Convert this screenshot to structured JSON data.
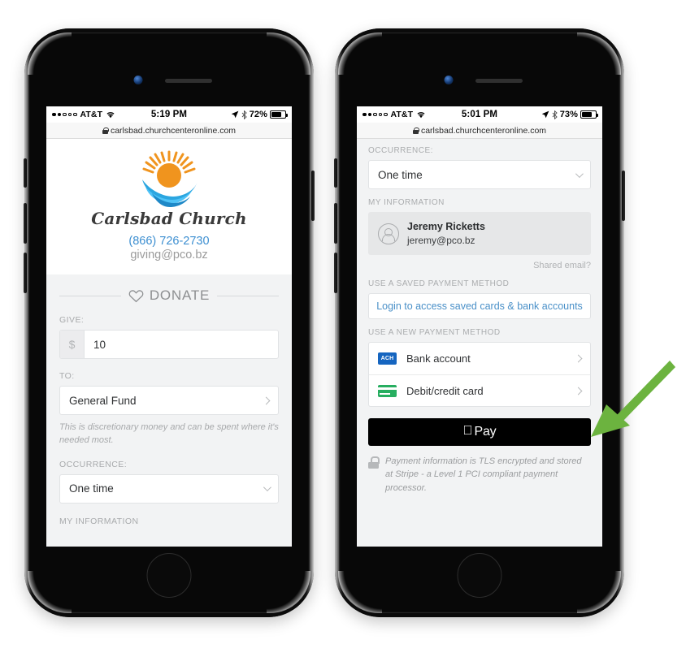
{
  "phones": {
    "left": {
      "status_bar": {
        "signal_dots_filled": 2,
        "signal_dots_total": 5,
        "carrier": "AT&T",
        "wifi_icon": "wifi-icon",
        "time": "5:19 PM",
        "location_icon": "location-arrow-icon",
        "bluetooth_icon": "bluetooth-icon",
        "battery_percent": "72%",
        "battery_level": 72
      },
      "url_bar": {
        "lock_icon": "lock-icon",
        "url": "carlsbad.churchcenteronline.com"
      },
      "hero": {
        "logo_icon": "sun-wave-logo-icon",
        "church_name": "Carlsbad Church",
        "phone": "(866) 726-2730",
        "email": "giving@pco.bz"
      },
      "donate_header": {
        "heart_icon": "heart-outline-icon",
        "title": "DONATE"
      },
      "form": {
        "give_label": "GIVE:",
        "currency_symbol": "$",
        "amount_value": "10",
        "to_label": "TO:",
        "fund_value": "General Fund",
        "fund_chevron_icon": "chevron-right-icon",
        "fund_helper": "This is discretionary money and can be spent where it's needed most.",
        "occurrence_label": "OCCURRENCE:",
        "occurrence_value": "One time",
        "occurrence_chevron_icon": "chevron-down-icon",
        "next_section_label": "MY INFORMATION"
      }
    },
    "right": {
      "status_bar": {
        "signal_dots_filled": 2,
        "signal_dots_total": 5,
        "carrier": "AT&T",
        "wifi_icon": "wifi-icon",
        "time": "5:01 PM",
        "location_icon": "location-arrow-icon",
        "bluetooth_icon": "bluetooth-icon",
        "battery_percent": "73%",
        "battery_level": 73
      },
      "url_bar": {
        "lock_icon": "lock-icon",
        "url": "carlsbad.churchcenteronline.com"
      },
      "occurrence": {
        "label": "OCCURRENCE:",
        "value": "One time",
        "chevron_icon": "chevron-down-icon"
      },
      "my_information": {
        "label": "MY INFORMATION",
        "avatar_icon": "person-avatar-icon",
        "name": "Jeremy Ricketts",
        "email": "jeremy@pco.bz",
        "shared_email_link": "Shared email?"
      },
      "saved_payment": {
        "label": "USE A SAVED PAYMENT METHOD",
        "login_button": "Login to access saved cards & bank accounts"
      },
      "new_payment": {
        "label": "USE A NEW PAYMENT METHOD",
        "methods": [
          {
            "icon": "ach-bank-icon",
            "badge_text": "ACH",
            "name": "Bank account",
            "chevron_icon": "chevron-right-icon"
          },
          {
            "icon": "credit-card-icon",
            "badge_text": "",
            "name": "Debit/credit card",
            "chevron_icon": "chevron-right-icon"
          }
        ]
      },
      "apple_pay": {
        "apple_logo_icon": "apple-logo-icon",
        "label": "Pay"
      },
      "security_note": {
        "lock_icon": "lock-icon",
        "text": "Payment information is TLS encrypted and stored at Stripe - a Level 1 PCI compliant payment processor."
      }
    }
  },
  "annotation": {
    "arrow_icon": "green-arrow-icon",
    "arrow_color": "#6cb33f",
    "points_to": "apple-pay-button"
  },
  "colors": {
    "link_blue": "#3d8fd1",
    "login_blue": "#4a90c8",
    "ach_blue": "#1565c0",
    "card_green": "#27ae60",
    "arrow_green": "#6cb33f",
    "page_bg": "#f2f3f4",
    "logo_orange": "#f0941e",
    "logo_blue": "#2ba6e0"
  }
}
